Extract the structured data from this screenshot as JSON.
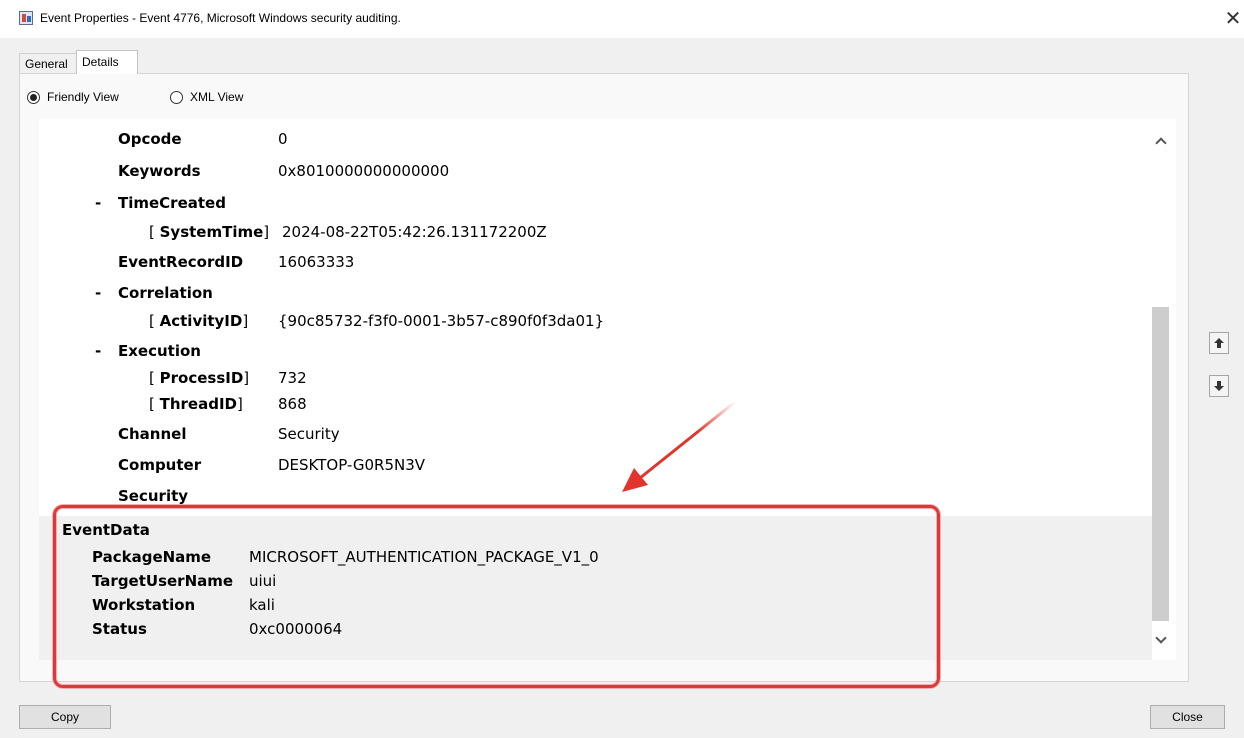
{
  "window": {
    "title": "Event Properties - Event 4776, Microsoft Windows security auditing.",
    "close_glyph": "✕"
  },
  "tabs": [
    {
      "label": "General",
      "active": false
    },
    {
      "label": "Details",
      "active": true
    }
  ],
  "view_options": {
    "friendly_label": "Friendly View",
    "xml_label": "XML View",
    "selected": "Friendly View"
  },
  "system": {
    "opcode_label": "Opcode",
    "opcode_value": "0",
    "keywords_label": "Keywords",
    "keywords_value": "0x8010000000000000",
    "timecreated_collapse": "-",
    "timecreated_label": "TimeCreated",
    "systemtime_open": "[ ",
    "systemtime_label": "SystemTime",
    "systemtime_close": "]",
    "systemtime_value": "2024-08-22T05:42:26.131172200Z",
    "eventrecordid_label": "EventRecordID",
    "eventrecordid_value": "16063333",
    "correlation_collapse": "-",
    "correlation_label": "Correlation",
    "activityid_open": "[ ",
    "activityid_label": "ActivityID",
    "activityid_close": "]",
    "activityid_value": "{90c85732-f3f0-0001-3b57-c890f0f3da01}",
    "execution_collapse": "-",
    "execution_label": "Execution",
    "processid_open": "[ ",
    "processid_label": "ProcessID",
    "processid_close": "]",
    "processid_value": "732",
    "threadid_open": "[ ",
    "threadid_label": "ThreadID",
    "threadid_close": "]",
    "threadid_value": "868",
    "channel_label": "Channel",
    "channel_value": "Security",
    "computer_label": "Computer",
    "computer_value": "DESKTOP-G0R5N3V",
    "security_label": "Security"
  },
  "event_data": {
    "header": "EventData",
    "packagename_label": "PackageName",
    "packagename_value": "MICROSOFT_AUTHENTICATION_PACKAGE_V1_0",
    "targetusername_label": "TargetUserName",
    "targetusername_value": "uiui",
    "workstation_label": "Workstation",
    "workstation_value": "kali",
    "status_label": "Status",
    "status_value": "0xc0000064"
  },
  "buttons": {
    "copy": "Copy",
    "close": "Close"
  },
  "colors": {
    "highlight": "#d93a3a",
    "arrow": "#e0342c"
  },
  "icons": [
    "app-icon",
    "close-icon",
    "chevron-up-icon",
    "chevron-down-icon",
    "arrow-up-icon",
    "arrow-down-icon",
    "annotation-arrow-icon"
  ]
}
